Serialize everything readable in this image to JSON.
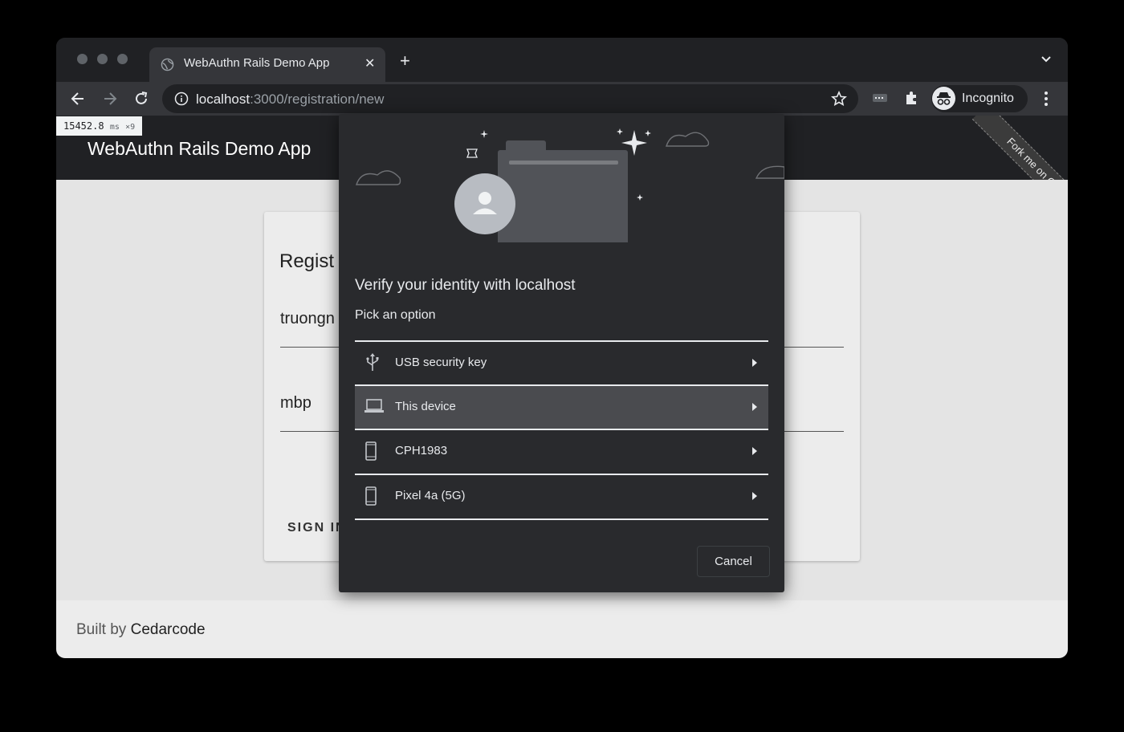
{
  "browser": {
    "tab": {
      "title": "WebAuthn Rails Demo App"
    },
    "address": {
      "host": "localhost",
      "rest": ":3000/registration/new"
    },
    "profile": {
      "label": "Incognito"
    },
    "timing": {
      "value": "15452.8",
      "unit": "ms",
      "count": "×9"
    }
  },
  "app": {
    "title": "WebAuthn Rails Demo App",
    "ribbon": "Fork me on GitHub",
    "card": {
      "heading_partial": "Regist",
      "username_partial": "truongn",
      "nickname_value": "mbp",
      "signin_partial": "SIGN IN"
    },
    "footer": {
      "prefix": "Built by ",
      "link": "Cedarcode"
    }
  },
  "dialog": {
    "title": "Verify your identity with localhost",
    "subtitle": "Pick an option",
    "options": [
      {
        "label": "USB security key",
        "icon": "usb-icon"
      },
      {
        "label": "This device",
        "icon": "laptop-icon",
        "selected": true
      },
      {
        "label": "CPH1983",
        "icon": "phone-icon"
      },
      {
        "label": "Pixel 4a (5G)",
        "icon": "phone-icon"
      }
    ],
    "cancel_label": "Cancel"
  },
  "colors": {
    "dialog_bg": "#292a2d",
    "selected_row": "#4a4b4f",
    "chrome_dark": "#202124"
  }
}
